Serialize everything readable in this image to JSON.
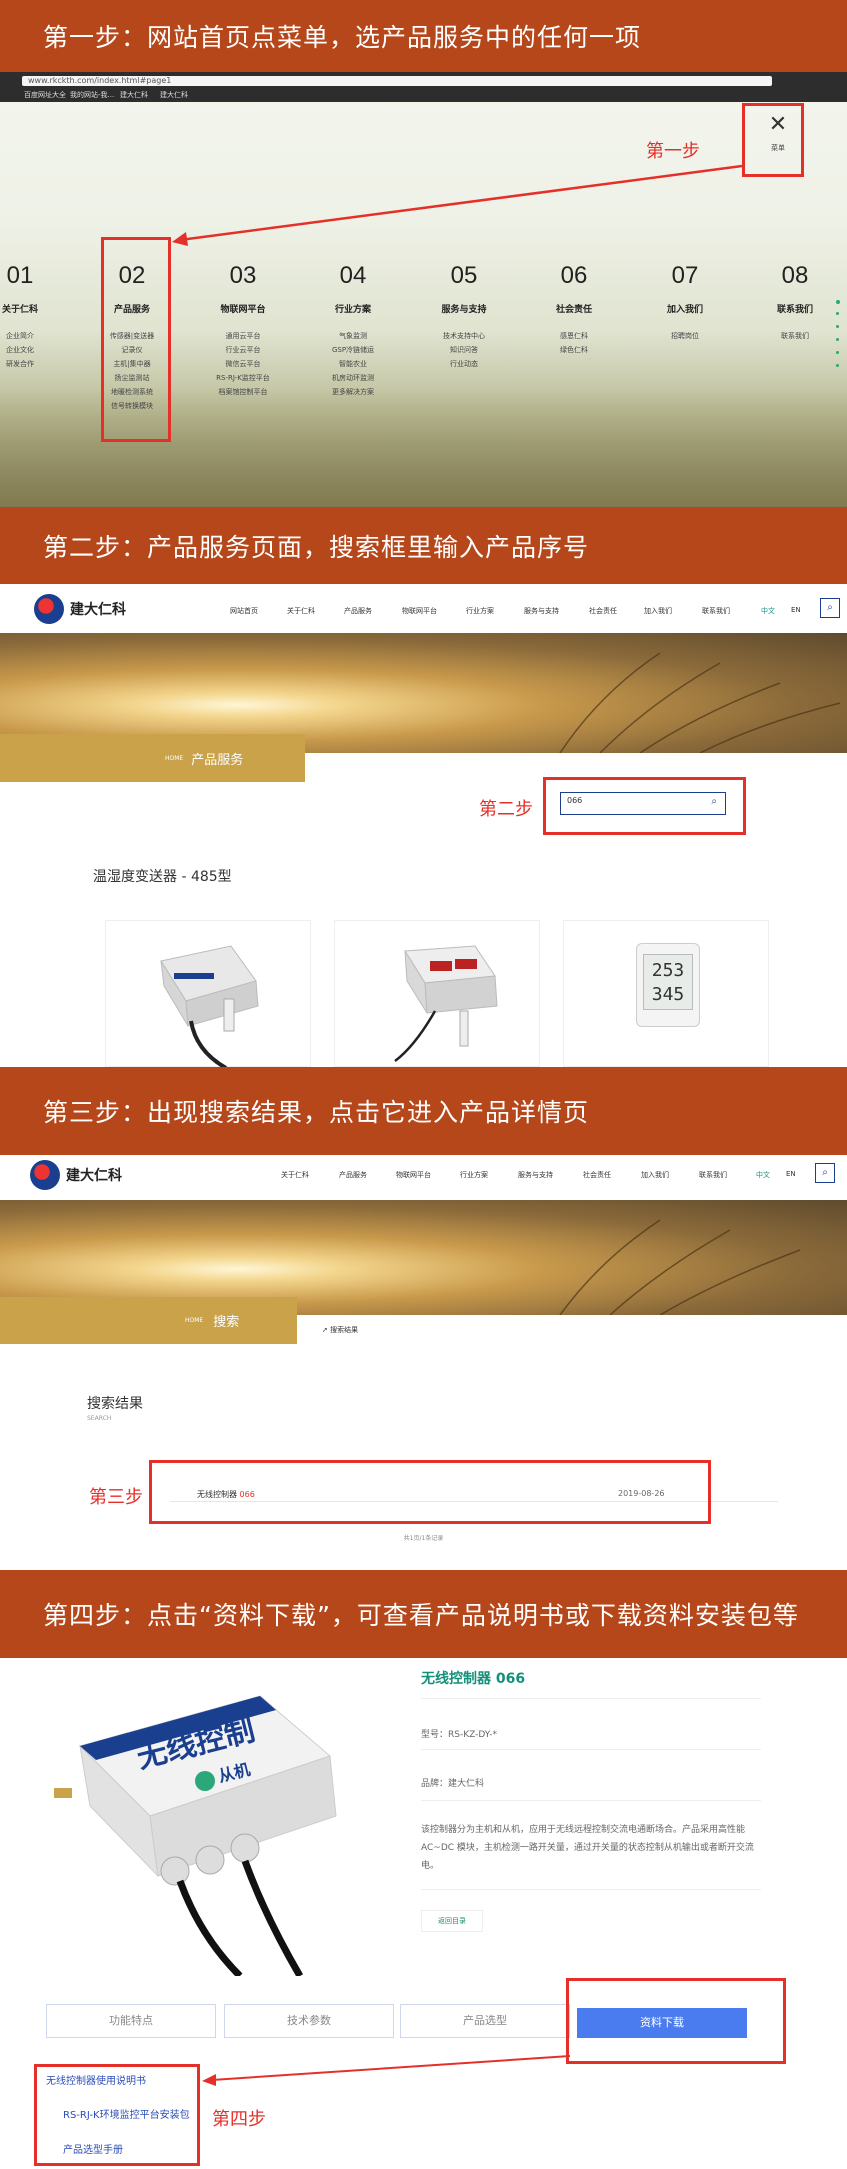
{
  "steps": [
    {
      "title": "第一步：网站首页点菜单，选产品服务中的任何一项",
      "label": "第一步"
    },
    {
      "title": "第二步：产品服务页面，搜索框里输入产品序号",
      "label": "第二步"
    },
    {
      "title": "第三步：出现搜索结果，点击它进入产品详情页",
      "label": "第三步"
    },
    {
      "title": "第四步：点击“资料下载”，可查看产品说明书或下载资料安装包等",
      "label": "第四步"
    }
  ],
  "browser": {
    "url": "www.rkckth.com/index.html#page1",
    "bookmarks": [
      "百度网址大全",
      "我的网站-我...",
      "建大仁科",
      "建大仁科"
    ]
  },
  "menu": {
    "close_label": "菜单",
    "columns": [
      {
        "num": "01",
        "title": "关于仁科",
        "items": [
          "企业简介",
          "企业文化",
          "研发合作"
        ]
      },
      {
        "num": "02",
        "title": "产品服务",
        "items": [
          "传感器|变送器",
          "记录仪",
          "主机|集中器",
          "扬尘监测站",
          "地暖检测系统",
          "信号转换模块"
        ]
      },
      {
        "num": "03",
        "title": "物联网平台",
        "items": [
          "通用云平台",
          "行业云平台",
          "微信云平台",
          "RS-RJ-K监控平台",
          "档案馆控制平台"
        ]
      },
      {
        "num": "04",
        "title": "行业方案",
        "items": [
          "气象监测",
          "GSP冷链储运",
          "智能农业",
          "机房动环监测",
          "更多解决方案"
        ]
      },
      {
        "num": "05",
        "title": "服务与支持",
        "items": [
          "技术支持中心",
          "知识问答",
          "行业动态"
        ]
      },
      {
        "num": "06",
        "title": "社会责任",
        "items": [
          "感恩仁科",
          "绿色仁科"
        ]
      },
      {
        "num": "07",
        "title": "加入我们",
        "items": [
          "招聘岗位"
        ]
      },
      {
        "num": "08",
        "title": "联系我们",
        "items": [
          "联系我们"
        ]
      }
    ]
  },
  "site": {
    "logo_text": "建大仁科",
    "nav2": [
      "网站首页",
      "关于仁科",
      "产品服务",
      "物联网平台",
      "行业方案",
      "服务与支持",
      "社会责任",
      "加入我们",
      "联系我们",
      "中文",
      "EN"
    ],
    "nav3": [
      "关于仁科",
      "产品服务",
      "物联网平台",
      "行业方案",
      "服务与支持",
      "社会责任",
      "加入我们",
      "联系我们",
      "中文",
      "EN"
    ]
  },
  "product_page": {
    "home": "HOME",
    "crumb": "产品服务",
    "search_value": "066",
    "category": "温湿度变送器 - 485型",
    "display_line1": "253",
    "display_line2": "345"
  },
  "search_page": {
    "home": "HOME",
    "crumb": "搜索",
    "crumb2": "搜索结果",
    "heading": "搜索结果",
    "heading_en": "SEARCH",
    "result_name": "无线控制器",
    "result_id": "066",
    "result_date": "2019-08-26",
    "pager": "共1页/1条记录"
  },
  "detail": {
    "title": "无线控制器 066",
    "model": "型号：RS-KZ-DY-*",
    "brand": "品牌：建大仁科",
    "desc": "该控制器分为主机和从机，应用于无线远程控制交流电通断场合。产品采用高性能AC~DC 模块，主机检测一路开关量，通过开关量的状态控制从机输出或者断开交流电。",
    "back": "返回目录",
    "device_text1": "无线控制",
    "device_text2": "从机",
    "tabs": [
      "功能特点",
      "技术参数",
      "产品选型",
      "资料下载"
    ],
    "downloads": [
      "无线控制器使用说明书",
      "RS-RJ-K环境监控平台安装包",
      "产品选型手册"
    ]
  },
  "colors": {
    "banner": "#b5471a",
    "accent_red": "#e5302a",
    "brand_blue": "#1a3f8f",
    "download_blue": "#4a7cf0",
    "gold": "#c9a24a"
  }
}
